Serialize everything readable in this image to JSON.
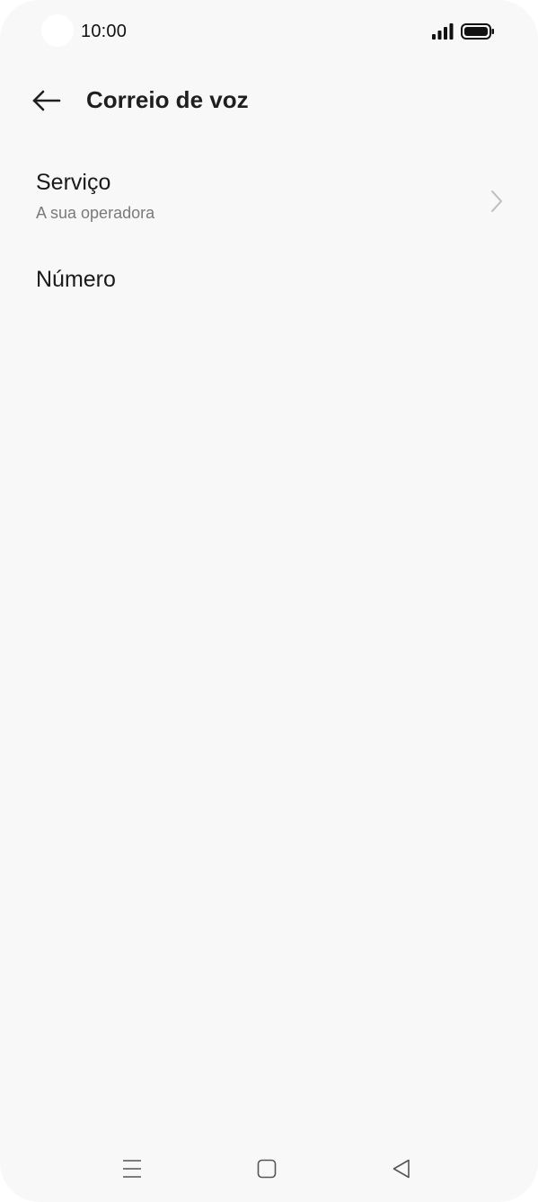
{
  "status_bar": {
    "time": "10:00",
    "signal_icon": "signal-bars-icon",
    "battery_icon": "battery-full-icon"
  },
  "app_bar": {
    "back_icon": "arrow-left-icon",
    "title": "Correio de voz"
  },
  "settings": {
    "items": [
      {
        "title": "Serviço",
        "subtitle": "A sua operadora",
        "icon": "chevron-right-icon"
      },
      {
        "title": "Número"
      }
    ]
  },
  "nav_bar": {
    "menu_icon": "menu-lines-icon",
    "home_icon": "square-home-icon",
    "back_icon": "triangle-back-icon"
  },
  "colors": {
    "background": "#f8f8f8",
    "text_primary": "#1a1a1a",
    "text_secondary": "#7a7a7a",
    "chevron": "#bdbdbd"
  }
}
